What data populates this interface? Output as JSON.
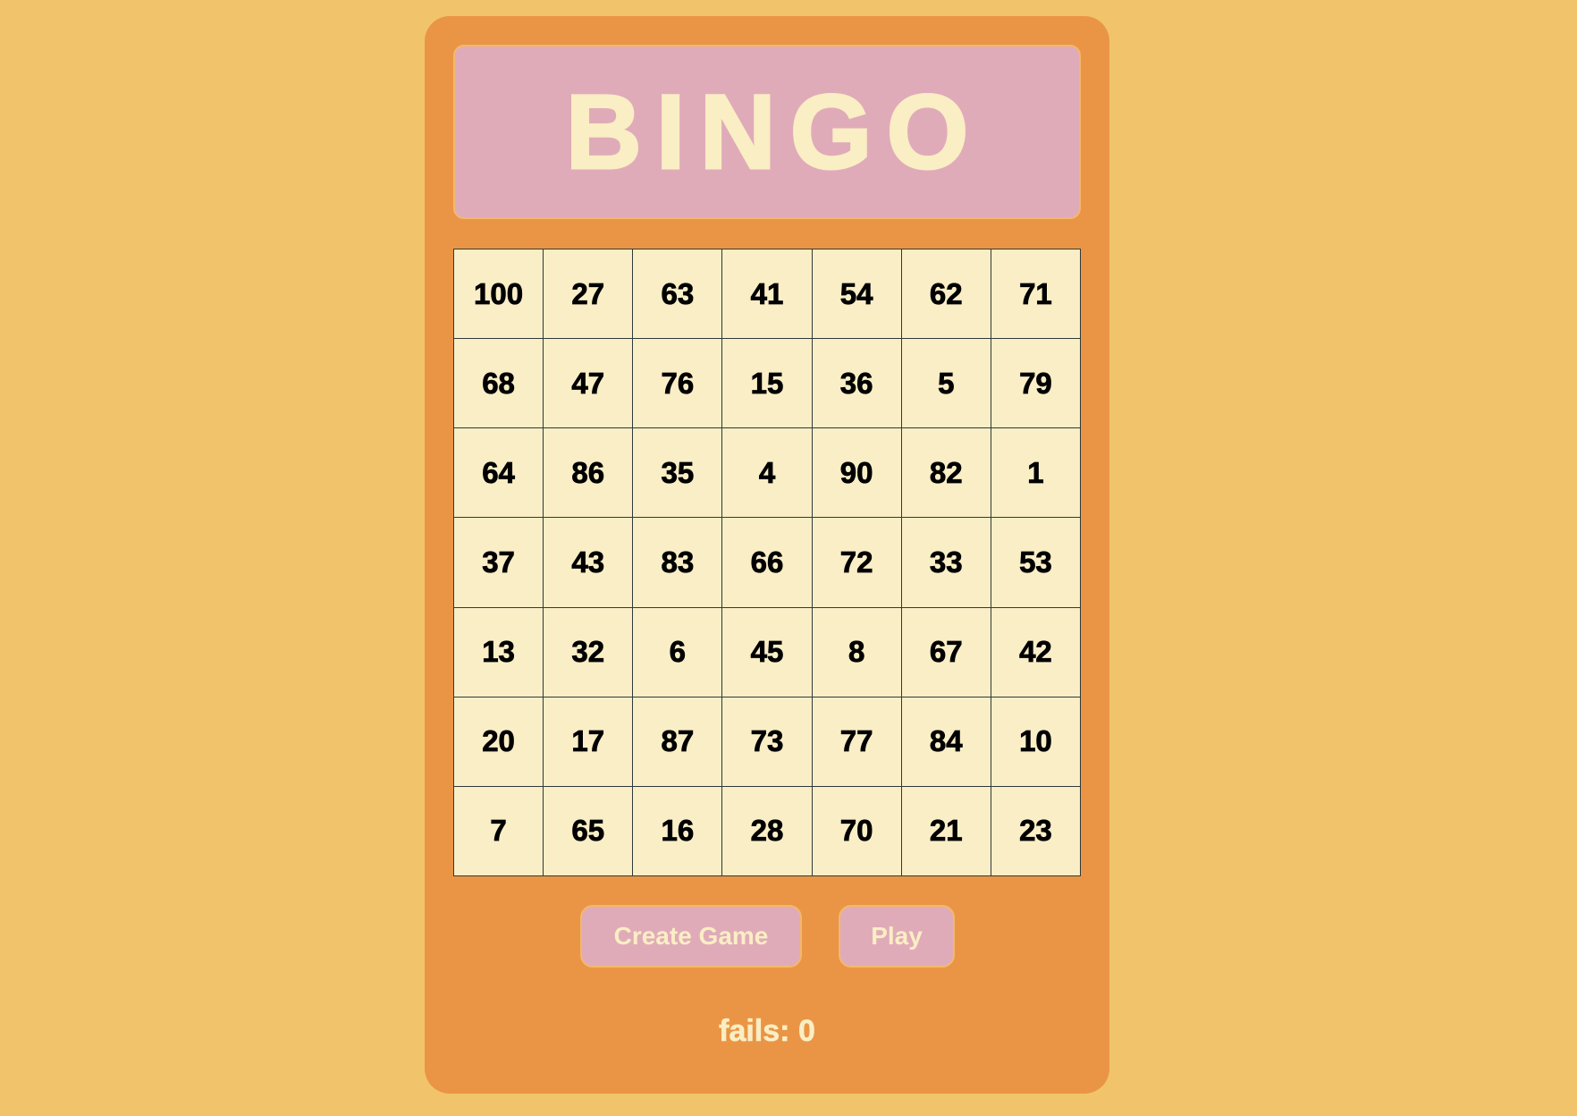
{
  "header": {
    "title": "BINGO"
  },
  "board": {
    "rows": [
      [
        "100",
        "27",
        "63",
        "41",
        "54",
        "62",
        "71"
      ],
      [
        "68",
        "47",
        "76",
        "15",
        "36",
        "5",
        "79"
      ],
      [
        "64",
        "86",
        "35",
        "4",
        "90",
        "82",
        "1"
      ],
      [
        "37",
        "43",
        "83",
        "66",
        "72",
        "33",
        "53"
      ],
      [
        "13",
        "32",
        "6",
        "45",
        "8",
        "67",
        "42"
      ],
      [
        "20",
        "17",
        "87",
        "73",
        "77",
        "84",
        "10"
      ],
      [
        "7",
        "65",
        "16",
        "28",
        "70",
        "21",
        "23"
      ]
    ]
  },
  "controls": {
    "create_label": "Create Game",
    "play_label": "Play"
  },
  "status": {
    "fails_label": "fails:",
    "fails_count": "0"
  },
  "colors": {
    "page_background": "#F1C46B",
    "card_background": "#EA9545",
    "accent_pink": "#E0ABB9",
    "cream": "#FAEEC4"
  }
}
